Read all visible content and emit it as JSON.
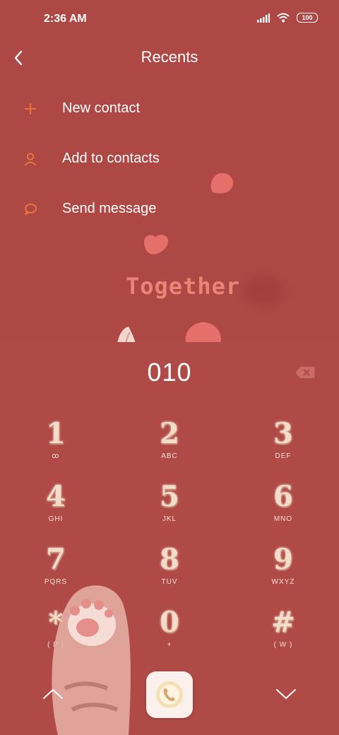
{
  "status": {
    "time": "2:36 AM",
    "battery": "100",
    "icons": [
      "signal-icon",
      "wifi-icon",
      "battery-icon"
    ]
  },
  "header": {
    "title": "Recents",
    "back_icon": "chevron-left-icon"
  },
  "actions": [
    {
      "label": "New contact",
      "icon": "plus-icon"
    },
    {
      "label": "Add to contacts",
      "icon": "person-icon"
    },
    {
      "label": "Send message",
      "icon": "message-icon"
    }
  ],
  "decoration": {
    "text": "Together"
  },
  "dialer": {
    "number": "010",
    "keys": [
      {
        "digit": "1",
        "letters": "ꝏ"
      },
      {
        "digit": "2",
        "letters": "ABC"
      },
      {
        "digit": "3",
        "letters": "DEF"
      },
      {
        "digit": "4",
        "letters": "GHI"
      },
      {
        "digit": "5",
        "letters": "JKL"
      },
      {
        "digit": "6",
        "letters": "MNO"
      },
      {
        "digit": "7",
        "letters": "PQRS"
      },
      {
        "digit": "8",
        "letters": "TUV"
      },
      {
        "digit": "9",
        "letters": "WXYZ"
      },
      {
        "digit": "*",
        "letters": "( P )"
      },
      {
        "digit": "0",
        "letters": "+"
      },
      {
        "digit": "#",
        "letters": "( W )"
      }
    ]
  },
  "colors": {
    "background": "#ad4845",
    "accent": "#f0763b",
    "digit": "#f4dccb"
  }
}
